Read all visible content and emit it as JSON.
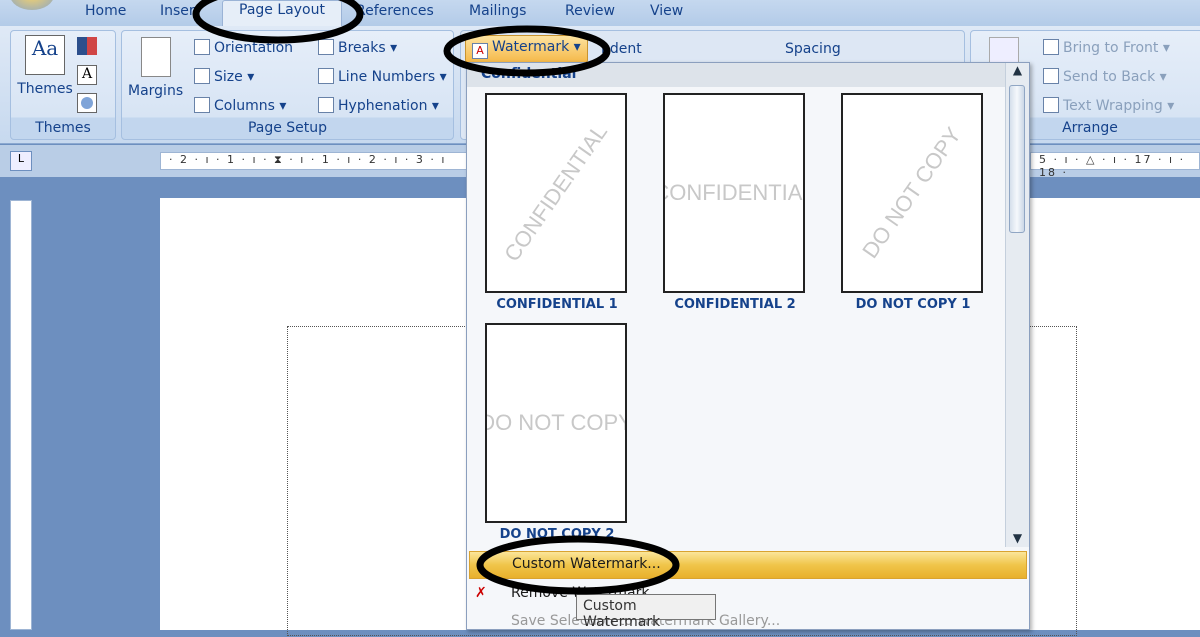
{
  "tabs": [
    "Home",
    "Inser",
    "Page Layout",
    "References",
    "Mailings",
    "Review",
    "View"
  ],
  "ribbon": {
    "themes": {
      "button": "Themes",
      "group": "Themes"
    },
    "page_setup": {
      "margins": "Margins",
      "orientation": "Orientation",
      "size": "Size",
      "columns": "Columns",
      "breaks": "Breaks",
      "line_numbers": "Line Numbers",
      "hyphenation": "Hyphenation",
      "group": "Page Setup"
    },
    "page_background": {
      "watermark": "Watermark"
    },
    "paragraph": {
      "indent": "ndent",
      "spacing": "Spacing"
    },
    "arrange": {
      "bring_to_front": "Bring to Front",
      "send_to_back": "Send to Back",
      "text_wrapping": "Text Wrapping",
      "group": "Arrange"
    }
  },
  "ruler": {
    "left": "· 2 · ı · 1 · ı · ⧗ · ı · 1 · ı · 2 · ı · 3 · ı",
    "right": "5 · ı · △ · ı · 17 · ı · 18 ·"
  },
  "watermark_menu": {
    "section": "Confidential",
    "items": [
      {
        "label": "CONFIDENTIAL 1",
        "text": "CONFIDENTIAL",
        "rotation": "diagonal"
      },
      {
        "label": "CONFIDENTIAL 2",
        "text": "CONFIDENTIAL",
        "rotation": "horizontal"
      },
      {
        "label": "DO NOT COPY 1",
        "text": "DO NOT COPY",
        "rotation": "diagonal"
      },
      {
        "label": "DO NOT COPY 2",
        "text": "DO NOT COPY",
        "rotation": "horizontal"
      }
    ],
    "custom": "Custom Watermark...",
    "remove": "Remove Watermark",
    "save": "Save Selection to Watermark Gallery...",
    "tooltip": "Custom Watermark"
  },
  "colors": {
    "highlight": "#f0c54a",
    "ribbon": "#dfe9f6",
    "text": "#15428b",
    "annotation": "#000000"
  }
}
